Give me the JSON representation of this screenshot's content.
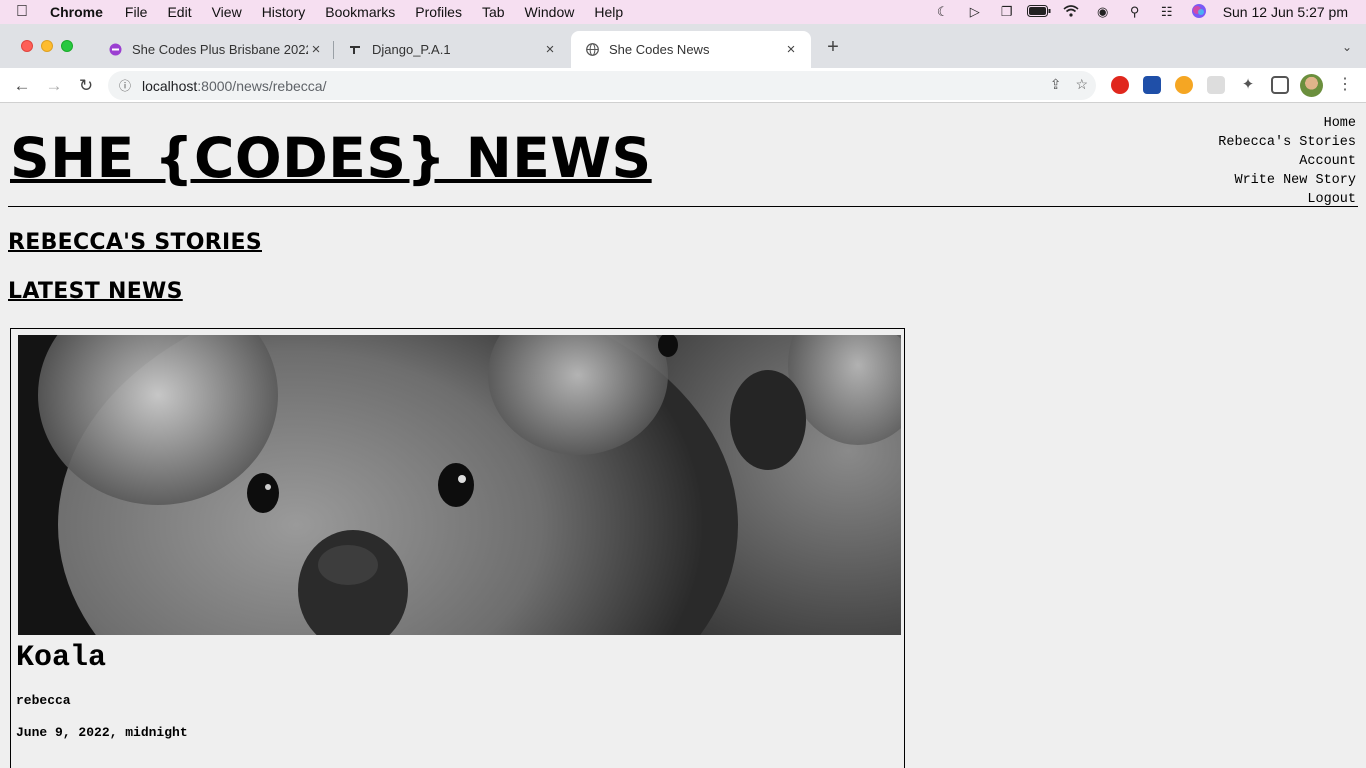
{
  "menubar": {
    "apple_icon": "apple-logo",
    "app_name": "Chrome",
    "items": [
      "File",
      "Edit",
      "View",
      "History",
      "Bookmarks",
      "Profiles",
      "Tab",
      "Window",
      "Help"
    ],
    "clock": "Sun 12 Jun  5:27 pm"
  },
  "tabs": [
    {
      "title": "She Codes Plus Brisbane 2022",
      "favicon": "purple-circle-icon"
    },
    {
      "title": "Django_P.A.1",
      "favicon": "notion-icon"
    },
    {
      "title": "She Codes News",
      "favicon": "globe-icon",
      "active": true
    }
  ],
  "toolbar": {
    "url_host": "localhost",
    "url_path": ":8000/news/rebecca/"
  },
  "site": {
    "title": "SHE {CODES} NEWS",
    "nav": [
      "Home",
      "Rebecca's Stories",
      "Account",
      "Write New Story",
      "Logout"
    ],
    "section_user": "REBECCA'S STORIES",
    "section_latest": "LATEST NEWS"
  },
  "story": {
    "title": "Koala",
    "author": "rebecca",
    "date": "June 9, 2022, midnight",
    "image_alt": "koala-photo"
  },
  "colors": {
    "menubar_bg": "#f6dff1",
    "tabstrip_bg": "#dfe1e5",
    "page_bg": "#efefef"
  }
}
